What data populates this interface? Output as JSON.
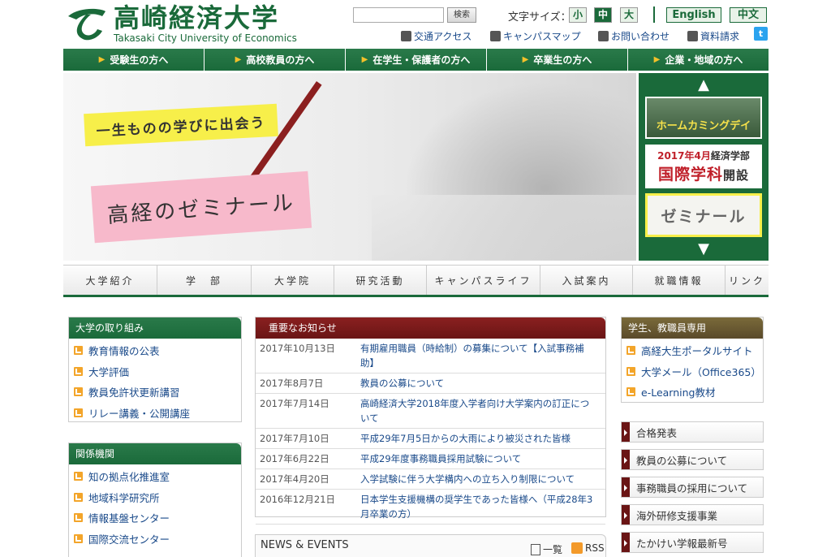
{
  "header": {
    "logo_title": "高崎経済大学",
    "logo_subtitle": "Takasaki City University of Economics",
    "search_button": "検索",
    "font_size_label": "文字サイズ：",
    "font_sizes": [
      "小",
      "中",
      "大"
    ],
    "lang_en": "English",
    "lang_zh": "中文",
    "util_links": [
      "交通アクセス",
      "キャンパスマップ",
      "お問い合わせ",
      "資料請求"
    ],
    "twitter": "t"
  },
  "audience_nav": [
    "受験生の方へ",
    "高校教員の方へ",
    "在学生・保護者の方へ",
    "卒業生の方へ",
    "企業・地域の方へ"
  ],
  "hero": {
    "tagline": "一生ものの学びに出会う",
    "title": "高経のゼミナール"
  },
  "side_banners": {
    "homecoming": "ホームカミングデイ",
    "intl_line1_date": "2017年4月",
    "intl_line1_rest": "経済学部",
    "intl_line2_main": "国際学科",
    "intl_line2_suffix": "開設",
    "seminar": "ゼミナール"
  },
  "main_nav": [
    "大学紹介",
    "学　部",
    "大学院",
    "研究活動",
    "キャンパスライフ",
    "入試案内",
    "就職情報",
    "リンク"
  ],
  "left_boxes": [
    {
      "title": "大学の取り組み",
      "items": [
        "教育情報の公表",
        "大学評価",
        "教員免許状更新講習",
        "リレー講義・公開講座"
      ]
    },
    {
      "title": "関係機関",
      "items": [
        "知の拠点化推進室",
        "地域科学研究所",
        "情報基盤センター",
        "国際交流センター"
      ]
    }
  ],
  "notices": {
    "title": "重要なお知らせ",
    "rows": [
      {
        "date": "2017年10月13日",
        "title": "有期雇用職員（時給制）の募集について【入試事務補助】"
      },
      {
        "date": "2017年8月7日",
        "title": "教員の公募について"
      },
      {
        "date": "2017年7月14日",
        "title": "高崎経済大学2018年度入学者向け大学案内の訂正について"
      },
      {
        "date": "2017年7月10日",
        "title": "平成29年7月5日からの大雨により被災された皆様"
      },
      {
        "date": "2017年6月22日",
        "title": "平成29年度事務職員採用試験について"
      },
      {
        "date": "2017年4月20日",
        "title": "入学試験に伴う大学構内への立ち入り制限について"
      },
      {
        "date": "2016年12月21日",
        "title": "日本学生支援機構の奨学生であった皆様へ（平成28年3月卒業の方）"
      }
    ]
  },
  "news": {
    "title": "NEWS & EVENTS",
    "list_link": "一覧",
    "rss_link": "RSS"
  },
  "staff": {
    "title": "学生、教職員専用",
    "items": [
      "高経大生ポータルサイト",
      "大学メール（Office365）",
      "e-Learning教材"
    ]
  },
  "right_links": [
    "合格発表",
    "教員の公募について",
    "事務職員の採用について",
    "海外研修支援事業",
    "たかけい学報最新号"
  ],
  "colors": {
    "brand_green": "#1a6a3a",
    "notice_red": "#6a1515",
    "link_blue": "#1a4a8a"
  }
}
